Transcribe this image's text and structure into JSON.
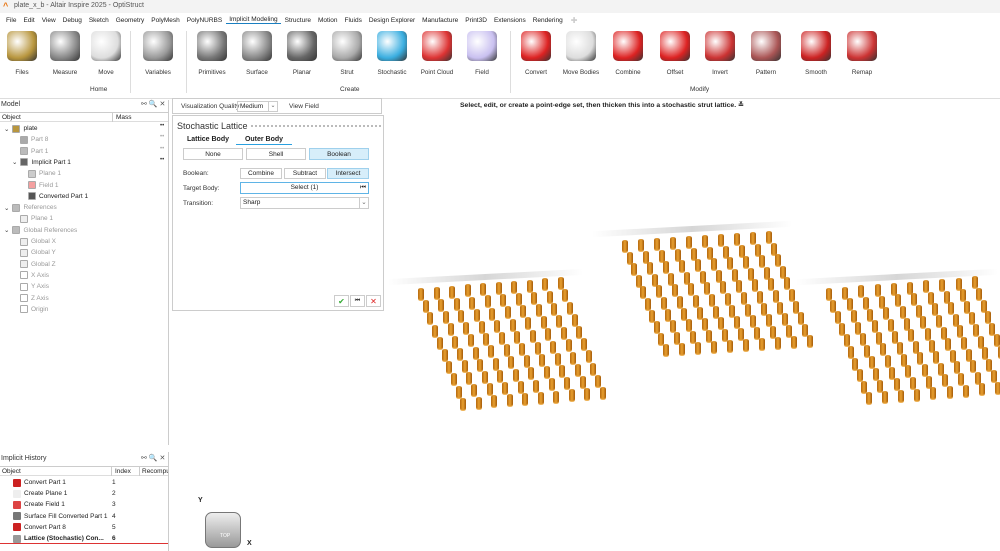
{
  "window": {
    "title": "plate_x_b - Altair Inspire 2025 - OptiStruct"
  },
  "menu": [
    "File",
    "Edit",
    "View",
    "Debug",
    "Sketch",
    "Geometry",
    "PolyMesh",
    "PolyNURBS",
    "Implicit Modeling",
    "Structure",
    "Motion",
    "Fluids",
    "Design Explorer",
    "Manufacture",
    "Print3D",
    "Extensions",
    "Rendering"
  ],
  "active_menu": "Implicit Modeling",
  "ribbon": {
    "items": [
      "Files",
      "Measure",
      "Move",
      "Variables",
      "Primitives",
      "Surface",
      "Planar",
      "Strut",
      "Stochastic",
      "Point Cloud",
      "Field",
      "Convert",
      "Move Bodies",
      "Combine",
      "Offset",
      "Invert",
      "Pattern",
      "Smooth",
      "Remap"
    ],
    "groups": [
      "Home",
      "Create",
      "Modify"
    ]
  },
  "hint": "Select, edit, or create a point-edge set, then thicken this into a stochastic strut lattice.",
  "model": {
    "title": "Model",
    "columns": [
      "Object",
      "Mass"
    ],
    "rows": [
      "plate",
      "Part 8",
      "Part 1",
      "Implicit Part 1",
      "Plane 1",
      "Field 1",
      "Converted Part 1",
      "References",
      "Plane 1",
      "Global References",
      "Global X",
      "Global Y",
      "Global Z",
      "X Axis",
      "Y Axis",
      "Z Axis",
      "Origin"
    ]
  },
  "viz": {
    "label": "Visualization Quality",
    "value": "Medium",
    "view_field": "View Field"
  },
  "dialog": {
    "title": "Stochastic Lattice",
    "tabs": [
      "Lattice Body",
      "Outer Body"
    ],
    "modes": [
      "None",
      "Shell",
      "Boolean"
    ],
    "boolean_label": "Boolean:",
    "boolean_ops": [
      "Combine",
      "Subtract",
      "Intersect"
    ],
    "target_label": "Target Body:",
    "target_value": "Select (1)",
    "transition_label": "Transition:",
    "transition_value": "Sharp"
  },
  "history": {
    "title": "Implicit History",
    "columns": [
      "Object",
      "Index",
      "Recompu"
    ],
    "rows": [
      {
        "name": "Convert Part 1",
        "index": "1"
      },
      {
        "name": "Create Plane 1",
        "index": "2"
      },
      {
        "name": "Create Field 1",
        "index": "3"
      },
      {
        "name": "Surface Fill Converted Part 1",
        "index": "4"
      },
      {
        "name": "Convert Part 8",
        "index": "5"
      },
      {
        "name": "Lattice (Stochastic) Con...",
        "index": "6"
      }
    ]
  },
  "viewcube": {
    "face": "TOP",
    "x": "X",
    "y": "Y"
  }
}
